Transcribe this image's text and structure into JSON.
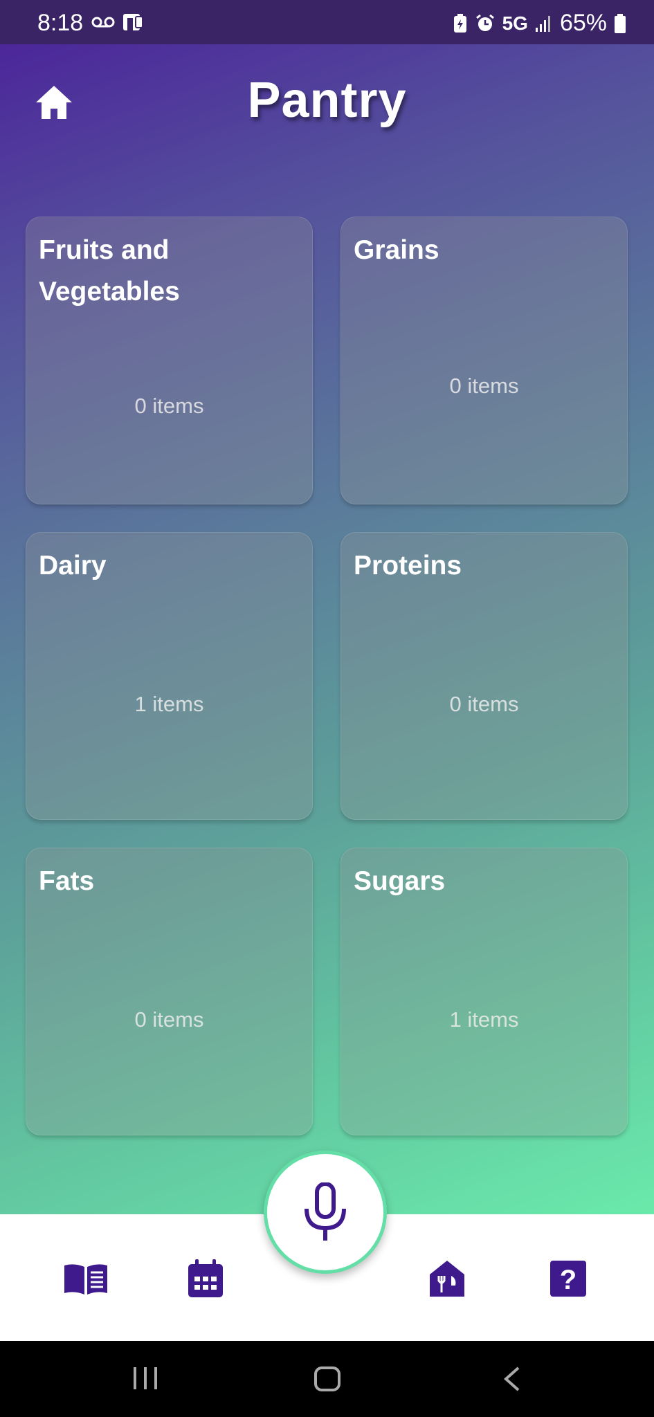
{
  "status_bar": {
    "time": "8:18",
    "network": "5G",
    "battery": "65%"
  },
  "header": {
    "title": "Pantry",
    "home_icon": "home-icon"
  },
  "categories": [
    {
      "name": "Fruits and Vegetables",
      "count": "0 items"
    },
    {
      "name": "Grains",
      "count": "0 items"
    },
    {
      "name": "Dairy",
      "count": "1 items"
    },
    {
      "name": "Proteins",
      "count": "0 items"
    },
    {
      "name": "Fats",
      "count": "0 items"
    },
    {
      "name": "Sugars",
      "count": "1 items"
    }
  ],
  "bottom_nav": {
    "items": [
      "book-icon",
      "calendar-icon",
      "microphone-icon",
      "pantry-icon",
      "help-icon"
    ],
    "accent": "#3f1a8c",
    "mic_ring": "#63dea6"
  }
}
